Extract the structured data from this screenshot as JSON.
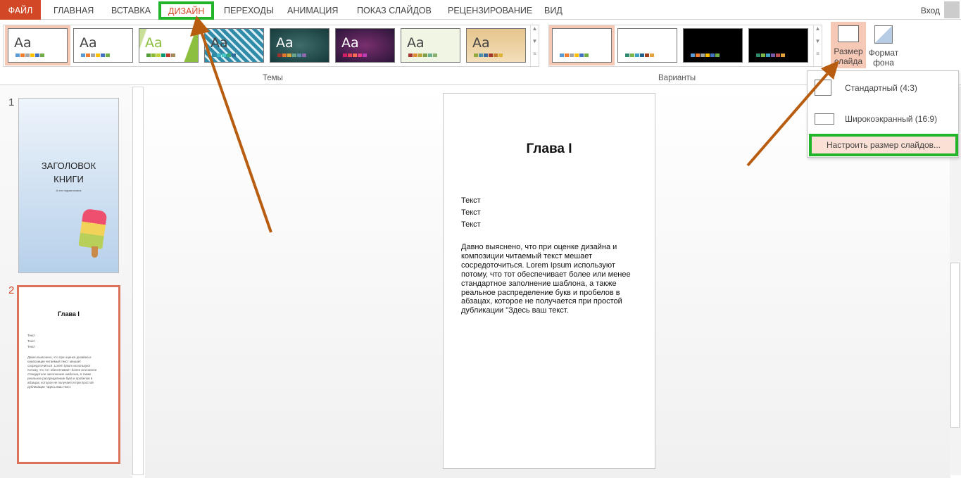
{
  "tabs": {
    "file": "ФАЙЛ",
    "items": [
      "ГЛАВНАЯ",
      "ВСТАВКА",
      "ДИЗАЙН",
      "ПЕРЕХОДЫ",
      "АНИМАЦИЯ",
      "ПОКАЗ СЛАЙДОВ",
      "РЕЦЕНЗИРОВАНИЕ",
      "ВИД"
    ],
    "active": "ДИЗАЙН",
    "login": "Вход"
  },
  "ribbon": {
    "themes_label": "Темы",
    "variants_label": "Варианты",
    "theme_thumb_text": "Aa",
    "slide_size": {
      "line1": "Размер",
      "line2": "слайда"
    },
    "format_bg": {
      "line1": "Формат",
      "line2": "фона"
    }
  },
  "colors": {
    "accent": "#d24726",
    "highlight": "#22b52c",
    "arrow": "#b85c10"
  },
  "slide_size_menu": {
    "standard": "Стандартный (4:3)",
    "widescreen": "Широкоэкранный (16:9)",
    "custom": "Настроить размер слайдов..."
  },
  "slides": [
    {
      "number": "1",
      "title_line1": "ЗАГОЛОВОК",
      "title_line2": "КНИГИ",
      "subtitle": "А это подзаголовок"
    },
    {
      "number": "2"
    }
  ],
  "current_slide": {
    "title": "Глава I",
    "lines": [
      "Текст",
      "Текст",
      "Текст"
    ],
    "paragraph": [
      "Давно выяснено, что при оценке дизайна и",
      "композиции читаемый текст мешает",
      "сосредоточиться. Lorem Ipsum используют",
      "потому, что тот обеспечивает более или менее",
      "стандартное заполнение шаблона, а также",
      "реальное распределение букв и пробелов в",
      "абзацах, которое не получается при простой",
      "дубликации \"Здесь ваш текст."
    ]
  }
}
